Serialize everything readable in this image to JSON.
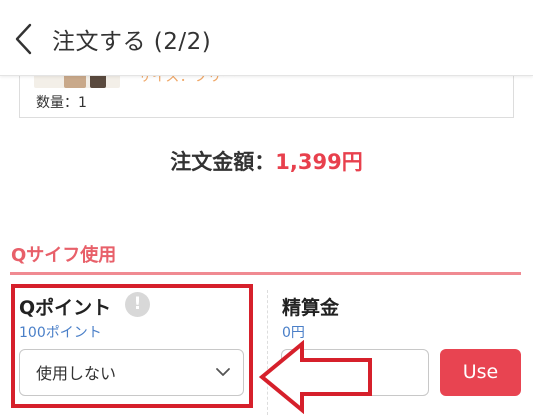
{
  "header": {
    "title": "注文する (2/2)",
    "back_icon": "chevron-left-icon"
  },
  "item": {
    "size_text": "サイズ：フリー",
    "quantity": "数量：1"
  },
  "total": {
    "label": "注文金額：",
    "amount": "1,399円"
  },
  "qsaif": {
    "section_title": "Qサイフ使用",
    "qpoint": {
      "label": "Qポイント",
      "info_icon_glyph": "!",
      "available": "100ポイント",
      "select_value": "使用しない"
    },
    "seisan": {
      "label": "精算金",
      "available": "0円",
      "input_value": "",
      "use_button": "Use"
    }
  },
  "colors": {
    "accent_red": "#e8404d",
    "section_pink": "#e8606a",
    "link_blue": "#4a7fc8",
    "annotation_red": "#d6202b"
  }
}
